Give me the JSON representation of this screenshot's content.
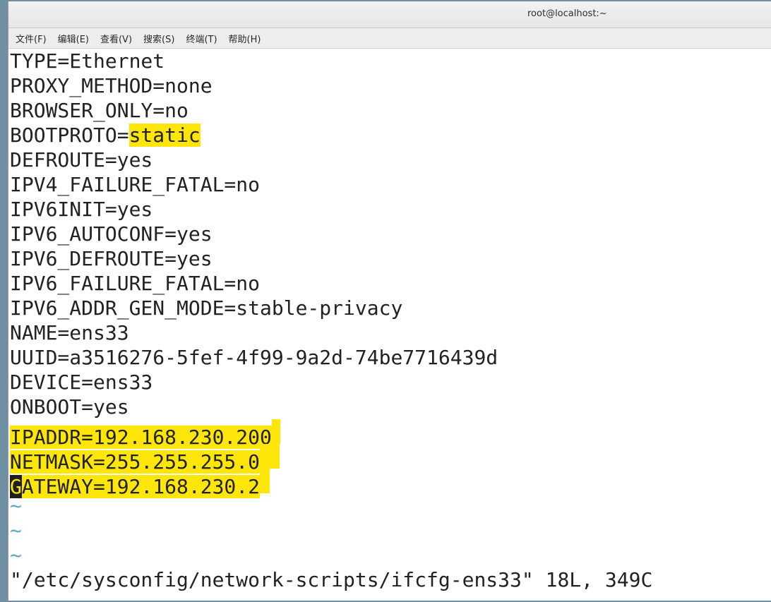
{
  "window": {
    "title": "root@localhost:~"
  },
  "menu": [
    {
      "label": "文件(F)"
    },
    {
      "label": "编辑(E)"
    },
    {
      "label": "查看(V)"
    },
    {
      "label": "搜索(S)"
    },
    {
      "label": "终端(T)"
    },
    {
      "label": "帮助(H)"
    }
  ],
  "lines": [
    "TYPE=Ethernet",
    "PROXY_METHOD=none",
    "BROWSER_ONLY=no",
    {
      "key": "BOOTPROTO=",
      "value": "static"
    },
    "DEFROUTE=yes",
    "IPV4_FAILURE_FATAL=no",
    "IPV6INIT=yes",
    "IPV6_AUTOCONF=yes",
    "IPV6_DEFROUTE=yes",
    "IPV6_FAILURE_FATAL=no",
    "IPV6_ADDR_GEN_MODE=stable-privacy",
    "NAME=ens33",
    "UUID=a3516276-5fef-4f99-9a2d-74be7716439d",
    "DEVICE=ens33",
    "ONBOOT=yes",
    "IPADDR=192.168.230.200",
    "NETMASK=255.255.255.0",
    {
      "cursor_char": "G",
      "rest": "ATEWAY=192.168.230.2"
    }
  ],
  "tildes": [
    "~",
    "~",
    "~"
  ],
  "status_line": "\"/etc/sysconfig/network-scripts/ifcfg-ens33\" 18L, 349C",
  "colors": {
    "highlight": "#ffe60a",
    "tilde": "#5aa6c8",
    "cursor": "#1f1f1f"
  }
}
